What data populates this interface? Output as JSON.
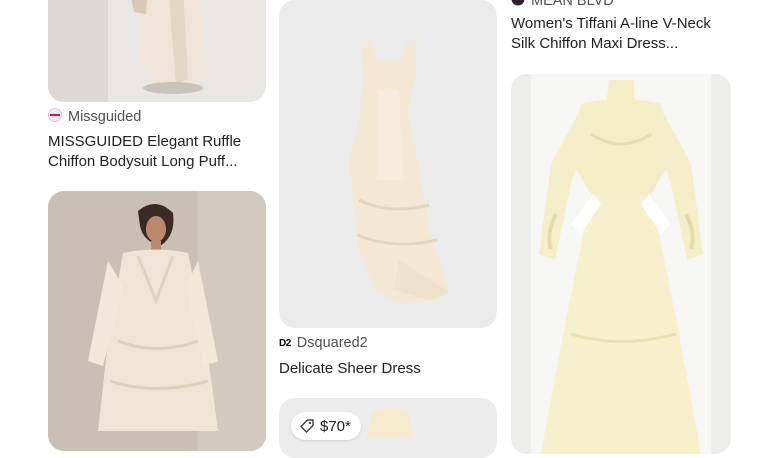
{
  "results": [
    {
      "source": "Missguided",
      "title_line1": "MISSGUIDED Elegant Ruffle",
      "title_line2": "Chiffon Bodysuit Long Puff..."
    },
    {
      "source": "Dsquared2",
      "source_logo": "D2",
      "title": "Delicate Sheer Dress"
    },
    {
      "price": "$70*"
    },
    {
      "source": "MEAN BLVD",
      "title_line1": "Women's Tiffani A-line V-Neck",
      "title_line2": "Silk Chiffon Maxi Dress..."
    }
  ],
  "icons": {
    "missguided": "missguided-favicon-icon",
    "dsquared2": "dsquared2-logo-icon",
    "meanblvd": "mean-blvd-favicon-icon",
    "price_tag": "price-tag-icon"
  },
  "colors": {
    "card_bg": "#ececec",
    "text_primary": "#202124",
    "text_secondary": "#4d5156",
    "dress_cream": "#f3e9d6",
    "dress_yellow": "#f4efc8"
  }
}
